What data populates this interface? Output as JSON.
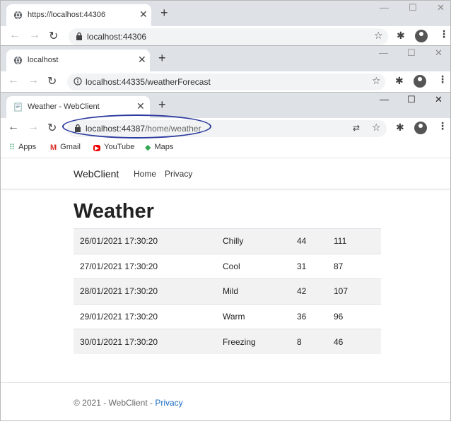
{
  "windows": [
    {
      "tab_title": "https://localhost:44306",
      "url_main": "localhost:44306",
      "url_dim": ""
    },
    {
      "tab_title": "localhost",
      "url_main": "localhost:44335/weatherForecast",
      "url_dim": ""
    },
    {
      "tab_title": "Weather - WebClient",
      "url_main": "localhost:44387",
      "url_dim": "/home/weather"
    }
  ],
  "bookmarks": [
    {
      "label": "Apps",
      "icon": "apps-grid-icon"
    },
    {
      "label": "Gmail",
      "icon": "gmail-icon"
    },
    {
      "label": "YouTube",
      "icon": "youtube-icon"
    },
    {
      "label": "Maps",
      "icon": "maps-icon"
    }
  ],
  "site": {
    "brand": "WebClient",
    "nav": [
      "Home",
      "Privacy"
    ],
    "heading": "Weather",
    "footer_text": "© 2021 - WebClient - ",
    "footer_link": "Privacy"
  },
  "forecasts": [
    {
      "date": "26/01/2021 17:30:20",
      "summary": "Chilly",
      "temp_c": "44",
      "temp_f": "111"
    },
    {
      "date": "27/01/2021 17:30:20",
      "summary": "Cool",
      "temp_c": "31",
      "temp_f": "87"
    },
    {
      "date": "28/01/2021 17:30:20",
      "summary": "Mild",
      "temp_c": "42",
      "temp_f": "107"
    },
    {
      "date": "29/01/2021 17:30:20",
      "summary": "Warm",
      "temp_c": "36",
      "temp_f": "96"
    },
    {
      "date": "30/01/2021 17:30:20",
      "summary": "Freezing",
      "temp_c": "8",
      "temp_f": "46"
    }
  ],
  "colors": {
    "annotation_oval": "#2b3a9e",
    "link": "#1a6dc5",
    "tab_strip": "#dee1e6"
  }
}
